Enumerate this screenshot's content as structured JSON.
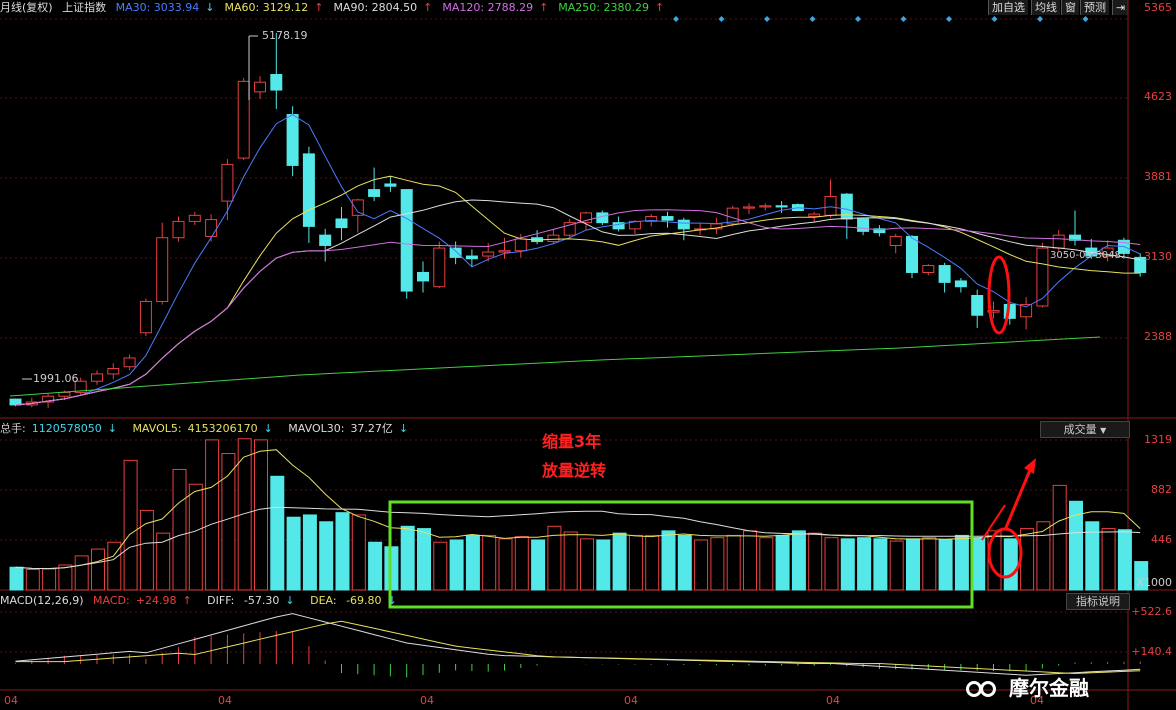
{
  "header": {
    "title": "月线(复权)",
    "index_name": "上证指数",
    "ma": [
      {
        "label": "MA30:",
        "value": "3033.94",
        "arrow": "↓",
        "color": "#4a7cff"
      },
      {
        "label": "MA60:",
        "value": "3129.12",
        "arrow": "↑",
        "color": "#e8e060"
      },
      {
        "label": "MA90:",
        "value": "2804.50",
        "arrow": "↑",
        "color": "#dddddd"
      },
      {
        "label": "MA120:",
        "value": "2788.29",
        "arrow": "↑",
        "color": "#d070e0"
      },
      {
        "label": "MA250:",
        "value": "2380.29",
        "arrow": "↑",
        "color": "#40d040"
      }
    ],
    "buttons": {
      "add": "加自选",
      "ma": "均线",
      "window": "窗",
      "forecast": "预测"
    }
  },
  "price_axis": [
    "5365",
    "4623",
    "3881",
    "3130",
    "2388"
  ],
  "annotations_price": {
    "high": "5178.19",
    "low": "1991.06",
    "last": "3050",
    "last2": "03",
    "last3": "3048."
  },
  "volume_header": {
    "total_label": "总手:",
    "total_value": "1120578050",
    "total_arrow": "↓",
    "mavol5_label": "MAVOL5:",
    "mavol5_value": "4153206170",
    "mavol5_arrow": "↓",
    "mavol30_label": "MAVOL30:",
    "mavol30_value": "37.27亿",
    "mavol30_arrow": "↓",
    "select": "成交量"
  },
  "volume_axis": [
    "1319",
    "882",
    "446",
    "X1000"
  ],
  "volume_annot": {
    "line1": "缩量3年",
    "line2": "放量逆转"
  },
  "macd_header": {
    "label": "MACD(12,26,9)",
    "macd_label": "MACD:",
    "macd_value": "+24.98",
    "macd_arrow": "↑",
    "diff_label": "DIFF:",
    "diff_value": "-57.30",
    "diff_arrow": "↓",
    "dea_label": "DEA:",
    "dea_value": "-69.80",
    "dea_arrow": "↓",
    "button": "指标说明"
  },
  "macd_axis": [
    "+522.6",
    "+140.4"
  ],
  "date_axis": [
    "04",
    "04",
    "04",
    "04",
    "04",
    "04"
  ],
  "watermark": "摩尔金融",
  "chart_data": {
    "type": "candlestick",
    "candles": [
      [
        2045,
        2015,
        2048,
        2008
      ],
      [
        2015,
        2030,
        2052,
        2003
      ],
      [
        2030,
        2060,
        2072,
        2000
      ],
      [
        2060,
        2080,
        2090,
        2040
      ],
      [
        2080,
        2140,
        2160,
        2070
      ],
      [
        2140,
        2180,
        2200,
        2120
      ],
      [
        2180,
        2210,
        2240,
        2150
      ],
      [
        2220,
        2270,
        2290,
        2200
      ],
      [
        2420,
        2620,
        2640,
        2400
      ],
      [
        2620,
        3080,
        3200,
        2600
      ],
      [
        3080,
        3210,
        3250,
        3050
      ],
      [
        3210,
        3260,
        3290,
        3180
      ],
      [
        3090,
        3225,
        3270,
        3050
      ],
      [
        3380,
        3710,
        3760,
        3220
      ],
      [
        3770,
        4580,
        4620,
        3750
      ],
      [
        4460,
        4570,
        4640,
        4380
      ],
      [
        4660,
        4480,
        5178.19,
        4270
      ],
      [
        4210,
        3700,
        4300,
        3600
      ],
      [
        3810,
        3170,
        3880,
        3040
      ],
      [
        3100,
        3020,
        3150,
        2900
      ],
      [
        3230,
        3160,
        3330,
        3060
      ],
      [
        3260,
        3390,
        3400,
        3120
      ],
      [
        3480,
        3420,
        3680,
        3380
      ],
      [
        3530,
        3510,
        3600,
        3460
      ],
      [
        3480,
        2690,
        3480,
        2638
      ],
      [
        2820,
        2760,
        2900,
        2680
      ],
      [
        2720,
        3000,
        3050,
        2710
      ],
      [
        3000,
        2930,
        3050,
        2880
      ],
      [
        2940,
        2920,
        2990,
        2860
      ],
      [
        2940,
        2970,
        3040,
        2900
      ],
      [
        2970,
        2980,
        3080,
        2920
      ],
      [
        2980,
        3070,
        3110,
        2930
      ],
      [
        3080,
        3050,
        3140,
        3030
      ],
      [
        3050,
        3100,
        3150,
        3030
      ],
      [
        3100,
        3200,
        3230,
        3080
      ],
      [
        3200,
        3280,
        3290,
        3140
      ],
      [
        3280,
        3200,
        3300,
        3180
      ],
      [
        3200,
        3150,
        3250,
        3130
      ],
      [
        3150,
        3210,
        3220,
        3110
      ],
      [
        3210,
        3250,
        3270,
        3170
      ],
      [
        3250,
        3220,
        3290,
        3160
      ],
      [
        3220,
        3150,
        3240,
        3060
      ],
      [
        3150,
        3150,
        3200,
        3100
      ],
      [
        3150,
        3190,
        3240,
        3110
      ],
      [
        3190,
        3320,
        3340,
        3170
      ],
      [
        3320,
        3330,
        3360,
        3270
      ],
      [
        3330,
        3340,
        3360,
        3300
      ],
      [
        3340,
        3330,
        3380,
        3280
      ],
      [
        3350,
        3300,
        3360,
        3300
      ],
      [
        3250,
        3270,
        3290,
        3200
      ],
      [
        3260,
        3420,
        3570,
        3240
      ],
      [
        3440,
        3230,
        3450,
        3070
      ],
      [
        3230,
        3130,
        3240,
        3100
      ],
      [
        3150,
        3120,
        3180,
        3090
      ],
      [
        3020,
        3090,
        3110,
        2960
      ],
      [
        3090,
        2820,
        3100,
        2780
      ],
      [
        2820,
        2870,
        2880,
        2800
      ],
      [
        2870,
        2750,
        2890,
        2680
      ],
      [
        2760,
        2720,
        2780,
        2680
      ],
      [
        2660,
        2530,
        2700,
        2450
      ],
      [
        2550,
        2560,
        2620,
        2510
      ],
      [
        2600,
        2510,
        2620,
        2470
      ],
      [
        2520,
        2600,
        2650,
        2440
      ],
      [
        2590,
        3000,
        3040,
        2580
      ],
      [
        3000,
        3100,
        3140,
        2980
      ],
      [
        3100,
        3060,
        3300,
        3020
      ],
      [
        3000,
        2940,
        3070,
        2920
      ],
      [
        2940,
        3000,
        3060,
        2900
      ],
      [
        3060,
        2960,
        3080,
        2920
      ],
      [
        2930,
        2820,
        2960,
        2790
      ]
    ],
    "volumes": [
      200,
      180,
      185,
      220,
      300,
      360,
      420,
      1140,
      700,
      500,
      1060,
      930,
      1320,
      1200,
      1330,
      1320,
      1000,
      640,
      660,
      600,
      680,
      660,
      420,
      380,
      560,
      540,
      420,
      440,
      480,
      480,
      450,
      470,
      440,
      560,
      510,
      450,
      440,
      500,
      480,
      480,
      520,
      480,
      440,
      460,
      480,
      520,
      460,
      480,
      520,
      500,
      460,
      450,
      460,
      450,
      430,
      450,
      460,
      440,
      480,
      460,
      520,
      450,
      540,
      600,
      920,
      780,
      600,
      540,
      530,
      250
    ],
    "ylim": [
      1800,
      5365
    ],
    "vol_ylim": [
      0,
      1319
    ]
  }
}
